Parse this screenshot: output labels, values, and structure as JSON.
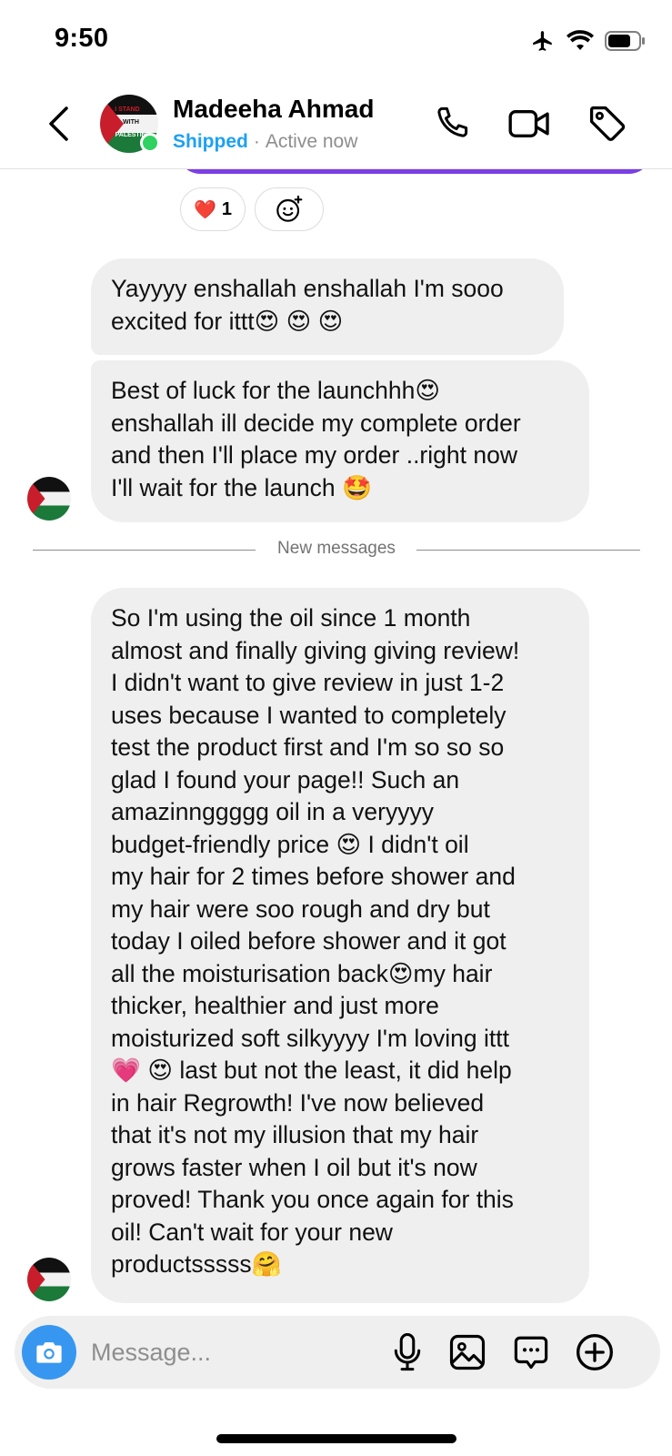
{
  "status_bar": {
    "time": "9:50"
  },
  "header": {
    "contact_name": "Madeeha Ahmad",
    "label": "Shipped",
    "separator": "·",
    "status": "Active now",
    "avatar_text": "I STAND WITH PALESTINE"
  },
  "reactions": [
    {
      "emoji": "❤️",
      "count": "1"
    }
  ],
  "messages": [
    {
      "text": "Yayyyy enshallah enshallah I'm sooo\nexcited for ittt😍 😍 😍"
    },
    {
      "text": "Best of luck for the launchhh😍\nenshallah ill decide my complete order\nand then I'll place my order ..right now\nI'll wait for the launch 🤩"
    },
    {
      "text": "So I'm using the oil since 1 month\nalmost and finally giving giving review!\nI didn't want to give review in just 1-2\nuses because I wanted to completely\ntest the product first and I'm so so so\nglad I found your page!! Such an\namazinnggggg oil in a veryyyy\nbudget-friendly price 😍  I didn't oil\nmy hair for 2 times before shower and\nmy hair were soo rough and dry but\ntoday I oiled before shower and it got\nall the moisturisation back😍my hair\nthicker, healthier and just more\nmoisturized soft silkyyyy I'm loving ittt\n💗 😍  last but not the least, it did help\nin hair Regrowth! I've now believed\nthat it's not my illusion that my hair\ngrows faster when I oil but it's now\nproved! Thank you once again for this\noil! Can't wait for your new\nproductsssss🤗"
    }
  ],
  "divider_label": "New messages",
  "composer": {
    "placeholder": "Message..."
  },
  "icons": {
    "back": "chevron-left-icon",
    "call": "phone-icon",
    "video": "video-camera-icon",
    "tag": "tag-icon",
    "camera": "camera-icon",
    "mic": "microphone-icon",
    "gallery": "image-icon",
    "sticker": "chat-bubble-icon",
    "add": "plus-circle-icon"
  },
  "colors": {
    "accent": "#3797f0",
    "shipped": "#1da1f2",
    "online": "#2fd161",
    "bubble": "#efefef",
    "sent_bubble": "#7b3fe4"
  }
}
